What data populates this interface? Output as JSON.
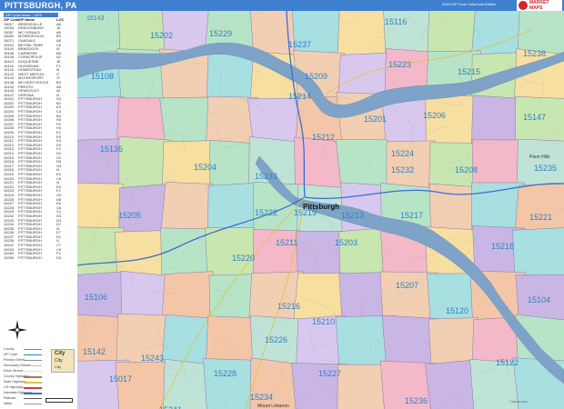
{
  "header": {
    "title": "PITTSBURGH, PA",
    "edition": "2023 ZIP Code ColorCast Edition",
    "logo_text": "MARKET MAPS"
  },
  "sidebar": {
    "legend_title": "ZIP Code Index - ZIPS",
    "table_headers": [
      "ZIP Code",
      "ZIP Name",
      "LOC"
    ],
    "zip_rows": [
      [
        "15017",
        "BRIDGEVILLE",
        "A6"
      ],
      [
        "15034",
        "DRAVOSBURG",
        "J6"
      ],
      [
        "15057",
        "MC DONALD",
        "A6"
      ],
      [
        "15063",
        "MONROEVILLE",
        "B3"
      ],
      [
        "15071",
        "OAKDALE",
        "A6"
      ],
      [
        "15102",
        "BETHEL PARK",
        "C6"
      ],
      [
        "15104",
        "BRADDOCK",
        "I5"
      ],
      [
        "15106",
        "CARNEGIE",
        "B5"
      ],
      [
        "15108",
        "CORAOPOLIS",
        "A2"
      ],
      [
        "15110",
        "DUQUESNE",
        "J6"
      ],
      [
        "15116",
        "GLENSHAW",
        "F1"
      ],
      [
        "15120",
        "HOMESTEAD",
        "I6"
      ],
      [
        "15122",
        "WEST MIFFLIN",
        "I7"
      ],
      [
        "15133",
        "MCKEESPORT",
        "J7"
      ],
      [
        "15136",
        "MC KEES ROCKS",
        "B3"
      ],
      [
        "15142",
        "PRESTO",
        "A6"
      ],
      [
        "15143",
        "SEWICKLEY",
        "A1"
      ],
      [
        "15147",
        "VERONA",
        "I2"
      ],
      [
        "15201",
        "PITTSBURGH",
        "G3"
      ],
      [
        "15202",
        "PITTSBURGH",
        "B2"
      ],
      [
        "15203",
        "PITTSBURGH",
        "E4"
      ],
      [
        "15204",
        "PITTSBURGH",
        "C4"
      ],
      [
        "15205",
        "PITTSBURGH",
        "B4"
      ],
      [
        "15206",
        "PITTSBURGH",
        "H3"
      ],
      [
        "15207",
        "PITTSBURGH",
        "F5"
      ],
      [
        "15208",
        "PITTSBURGH",
        "H4"
      ],
      [
        "15209",
        "PITTSBURGH",
        "E2"
      ],
      [
        "15210",
        "PITTSBURGH",
        "E5"
      ],
      [
        "15211",
        "PITTSBURGH",
        "D4"
      ],
      [
        "15212",
        "PITTSBURGH",
        "D3"
      ],
      [
        "15213",
        "PITTSBURGH",
        "F4"
      ],
      [
        "15214",
        "PITTSBURGH",
        "D2"
      ],
      [
        "15215",
        "PITTSBURGH",
        "G2"
      ],
      [
        "15216",
        "PITTSBURGH",
        "D5"
      ],
      [
        "15217",
        "PITTSBURGH",
        "G4"
      ],
      [
        "15218",
        "PITTSBURGH",
        "I4"
      ],
      [
        "15219",
        "PITTSBURGH",
        "E4"
      ],
      [
        "15220",
        "PITTSBURGH",
        "C5"
      ],
      [
        "15221",
        "PITTSBURGH",
        "I4"
      ],
      [
        "15222",
        "PITTSBURGH",
        "E3"
      ],
      [
        "15223",
        "PITTSBURGH",
        "F2"
      ],
      [
        "15224",
        "PITTSBURGH",
        "G3"
      ],
      [
        "15226",
        "PITTSBURGH",
        "D6"
      ],
      [
        "15227",
        "PITTSBURGH",
        "E6"
      ],
      [
        "15228",
        "PITTSBURGH",
        "C6"
      ],
      [
        "15229",
        "PITTSBURGH",
        "C1"
      ],
      [
        "15232",
        "PITTSBURGH",
        "G3"
      ],
      [
        "15233",
        "PITTSBURGH",
        "D3"
      ],
      [
        "15234",
        "PITTSBURGH",
        "D7"
      ],
      [
        "15235",
        "PITTSBURGH",
        "I3"
      ],
      [
        "15236",
        "PITTSBURGH",
        "E7"
      ],
      [
        "15237",
        "PITTSBURGH",
        "D1"
      ],
      [
        "15238",
        "PITTSBURGH",
        "I1"
      ],
      [
        "15241",
        "PITTSBURGH",
        "C7"
      ],
      [
        "15243",
        "PITTSBURGH",
        "C6"
      ],
      [
        "15260",
        "PITTSBURGH",
        "F4"
      ],
      [
        "15290",
        "PITTSBURGH",
        "D3"
      ]
    ],
    "legend_items": [
      {
        "label": "County",
        "color": "#9a6cc0"
      },
      {
        "label": "ZIP Code",
        "color": "#2b83c6"
      },
      {
        "label": "Primary Street",
        "color": "#8d8d8d"
      },
      {
        "label": "Secondary Streets",
        "color": "#bbbbbb"
      },
      {
        "label": "Minor Streets",
        "color": "#dddddd"
      },
      {
        "label": "County Highways",
        "color": "#a77b3f"
      },
      {
        "label": "State Highways",
        "color": "#e0c23a"
      },
      {
        "label": "US Highways",
        "color": "#d23a3a"
      },
      {
        "label": "Interstate Highways",
        "color": "#3a6dd2"
      },
      {
        "label": "Railroad",
        "color": "#555555"
      },
      {
        "label": "Water",
        "color": "#7fa3c8"
      }
    ],
    "sample_cities": [
      "City",
      "City",
      "City"
    ]
  },
  "map": {
    "water_color": "#7fa3c8",
    "city_label": "Pittsburgh",
    "place_labels": [
      "Penn Hills",
      "Mount Lebanon"
    ],
    "zip_labels": [
      "15143",
      "15202",
      "15229",
      "15237",
      "15116",
      "15223",
      "15238",
      "15108",
      "15209",
      "15215",
      "15214",
      "15212",
      "15201",
      "15206",
      "15147",
      "15136",
      "15204",
      "15233",
      "15224",
      "15232",
      "15208",
      "15235",
      "15205",
      "15222",
      "15219",
      "15213",
      "15217",
      "15221",
      "15211",
      "15203",
      "15218",
      "15220",
      "15207",
      "15106",
      "15216",
      "15210",
      "15120",
      "15104",
      "15226",
      "15142",
      "15243",
      "15017",
      "15228",
      "15227",
      "15122",
      "15241",
      "15234",
      "15236",
      "15133"
    ]
  },
  "footer": {
    "copyright": "© Market Maps"
  }
}
